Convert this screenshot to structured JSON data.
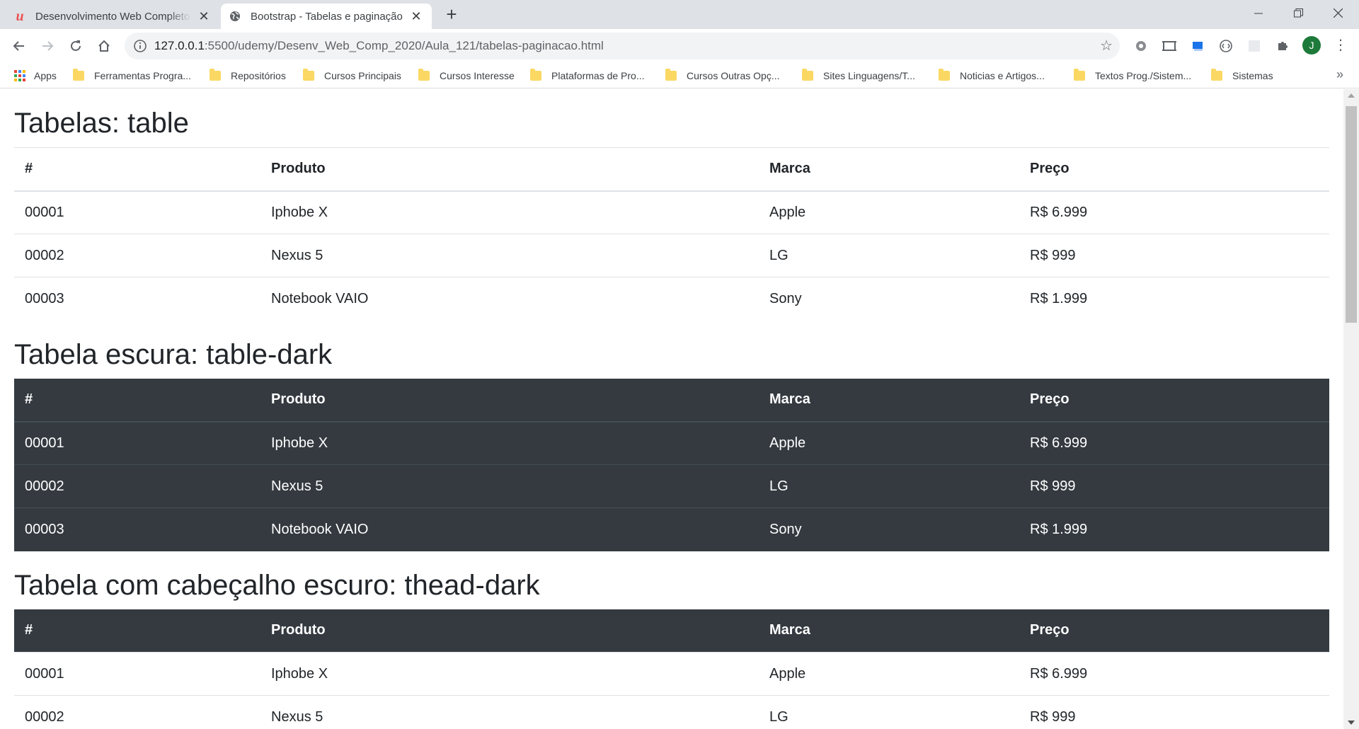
{
  "tabs": [
    {
      "title": "Desenvolvimento Web Completo",
      "icon": "udemy-icon"
    },
    {
      "title": "Bootstrap - Tabelas e paginação",
      "icon": "globe-icon"
    }
  ],
  "address": {
    "host": "127.0.0.1",
    "path": ":5500/udemy/Desenv_Web_Comp_2020/Aula_121/tabelas-paginacao.html"
  },
  "profile_initial": "J",
  "bookmarks": [
    "Apps",
    "Ferramentas Progra...",
    "Repositórios",
    "Cursos Principais",
    "Cursos Interesse",
    "Plataformas de Pro...",
    "Cursos Outras Opç...",
    "Sites Linguagens/T...",
    "Noticias e Artigos...",
    "Textos Prog./Sistem...",
    "Sistemas"
  ],
  "headers": [
    "#",
    "Produto",
    "Marca",
    "Preço"
  ],
  "sections": [
    {
      "title": "Tabelas: table",
      "rows": [
        [
          "00001",
          "Iphobe X",
          "Apple",
          "R$ 6.999"
        ],
        [
          "00002",
          "Nexus 5",
          "LG",
          "R$ 999"
        ],
        [
          "00003",
          "Notebook VAIO",
          "Sony",
          "R$ 1.999"
        ]
      ]
    },
    {
      "title": "Tabela escura: table-dark",
      "rows": [
        [
          "00001",
          "Iphobe X",
          "Apple",
          "R$ 6.999"
        ],
        [
          "00002",
          "Nexus 5",
          "LG",
          "R$ 999"
        ],
        [
          "00003",
          "Notebook VAIO",
          "Sony",
          "R$ 1.999"
        ]
      ]
    },
    {
      "title": "Tabela com cabeçalho escuro: thead-dark",
      "rows": [
        [
          "00001",
          "Iphobe X",
          "Apple",
          "R$ 6.999"
        ],
        [
          "00002",
          "Nexus 5",
          "LG",
          "R$ 999"
        ]
      ]
    }
  ],
  "colors": {
    "dark": "#343a40",
    "dark_border": "#454d55",
    "light_border": "#dee2e6",
    "text": "#212529"
  }
}
